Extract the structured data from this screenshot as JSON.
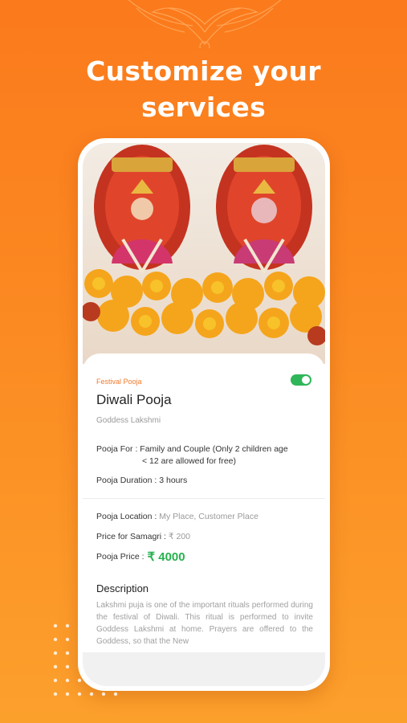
{
  "headline": "Customize your services",
  "pooja": {
    "category": "Festival Pooja",
    "toggle_on": true,
    "title": "Diwali Pooja",
    "deity": "Goddess Lakshmi",
    "for_label": "Pooja For :",
    "for_value_line1": "Family and Couple (Only 2 children age",
    "for_value_line2": "< 12 are allowed for free)",
    "duration_label": "Pooja Duration :",
    "duration_value": "3 hours",
    "location_label": "Pooja Location :",
    "location_value": "My Place, Customer Place",
    "samagri_label": "Price for Samagri :",
    "samagri_value": "₹ 200",
    "price_label": "Pooja Price :",
    "price_value": "₹ 4000",
    "description_heading": "Description",
    "description_text": "Lakshmi puja is one of the important rituals performed during the festival of Diwali. This ritual is performed to invite Goddess Lakshmi at home. Prayers are offered to the Goddess, so that the New"
  },
  "colors": {
    "background_top": "#fb7a1c",
    "background_bottom": "#fca02c",
    "accent_orange": "#f07a2b",
    "price_green": "#27b24f",
    "toggle_green": "#2fb659"
  }
}
